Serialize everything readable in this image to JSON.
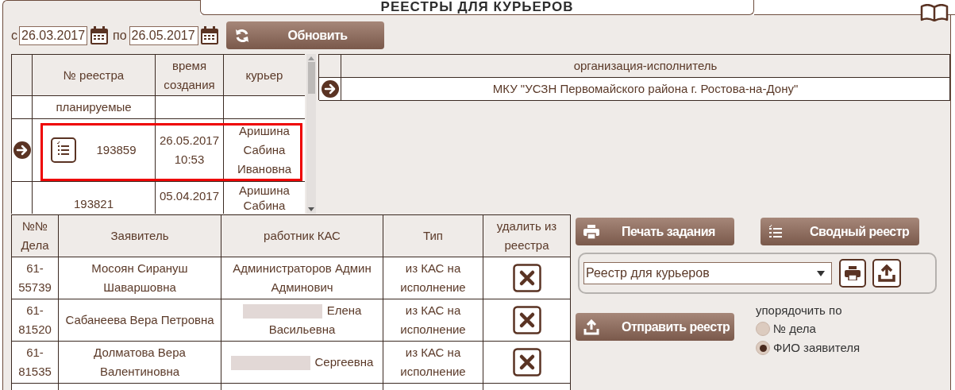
{
  "title": "РЕЕСТРЫ ДЛЯ КУРЬЕРОВ",
  "filter": {
    "from_label": "с",
    "from": "26.03.2017",
    "to_label": "по",
    "to": "26.05.2017",
    "refresh_button": "Обновить"
  },
  "registers": {
    "columns": [
      "№ реестра",
      "время создания",
      "курьер"
    ],
    "rows": [
      {
        "kind": "group",
        "label": "планируемые",
        "selected": false
      },
      {
        "kind": "register",
        "number": "193859",
        "created": "26.05.2017 10:53",
        "courier": "Аришина Сабина Ивановна",
        "selected": true,
        "report_icon": true
      },
      {
        "kind": "register",
        "number": "193821",
        "created": "05.04.2017",
        "courier": "Аришина Сабина",
        "selected": false,
        "report_icon": false
      }
    ]
  },
  "organizations": {
    "column": "организация-исполнитель",
    "rows": [
      {
        "name": "МКУ \"УСЗН Первомайского района г. Ростова-на-Дону\"",
        "selected": true
      }
    ]
  },
  "cases": {
    "columns": [
      "№№ Дела",
      "Заявитель",
      "работник КАС",
      "Тип",
      "удалить из реестра"
    ],
    "rows": [
      {
        "number": "61-55739",
        "applicant": "Мосоян Сирануш Шаваршовна",
        "worker": "Администраторов Админ Админович",
        "redacted": false,
        "type": "из КАС на исполнение"
      },
      {
        "number": "61-81520",
        "applicant": "Сабанеева Вера Петровна",
        "worker": "Елена Васильевна",
        "redacted": true,
        "type": "из КАС на исполнение"
      },
      {
        "number": "61-81535",
        "applicant": "Долматова Вера Валентиновна",
        "worker": "Сергеевна",
        "redacted": true,
        "type": "из КАС на исполнение"
      }
    ]
  },
  "actions": {
    "print_task": "Печать задания",
    "summary": "Сводный реестр",
    "report_select": "Реестр для курьеров",
    "send": "Отправить реестр"
  },
  "sort": {
    "label": "упорядочить по",
    "options": [
      {
        "label": "№ дела",
        "selected": false
      },
      {
        "label": "ФИО заявителя",
        "selected": true
      }
    ]
  }
}
